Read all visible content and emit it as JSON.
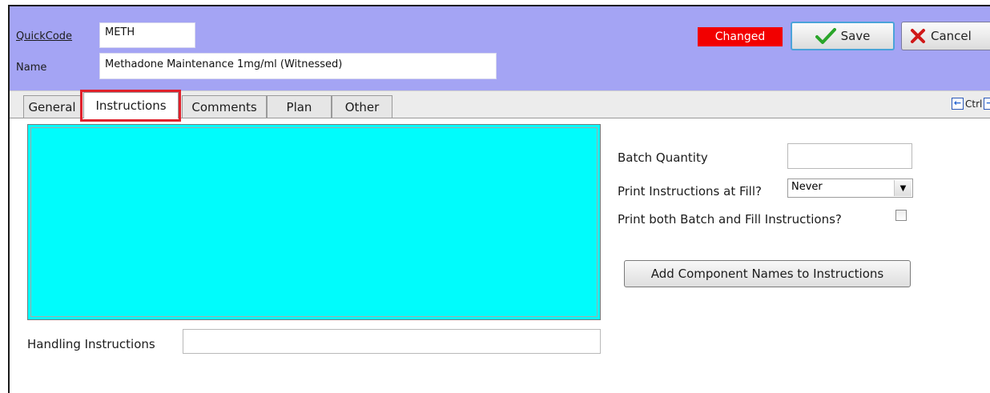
{
  "header": {
    "quickcode_label": "QuickCode",
    "quickcode_value": "METH",
    "name_label": "Name",
    "name_value": "Methadone Maintenance 1mg/ml (Witnessed)",
    "status_badge": "Changed",
    "save_label": "Save",
    "cancel_label": "Cancel",
    "colors": {
      "header_bg": "#a4a4f4",
      "badge_bg": "#f20000",
      "save_check": "#2aa52a",
      "cancel_x": "#d01818",
      "field_area": "#00fcfc"
    }
  },
  "tabs": [
    {
      "label": "General",
      "active": false
    },
    {
      "label": "Instructions",
      "active": true
    },
    {
      "label": "Comments",
      "active": false
    },
    {
      "label": "Plan",
      "active": false
    },
    {
      "label": "Other",
      "active": false
    }
  ],
  "nav": {
    "ctrl_label": "Ctrl"
  },
  "form": {
    "handling_label": "Handling Instructions",
    "handling_value": "",
    "batch_quantity_label": "Batch Quantity",
    "batch_quantity_value": "",
    "print_at_fill_label": "Print Instructions at Fill?",
    "print_at_fill_value": "Never",
    "print_both_label": "Print both Batch and Fill Instructions?",
    "print_both_checked": false,
    "add_component_button": "Add Component Names to Instructions"
  }
}
